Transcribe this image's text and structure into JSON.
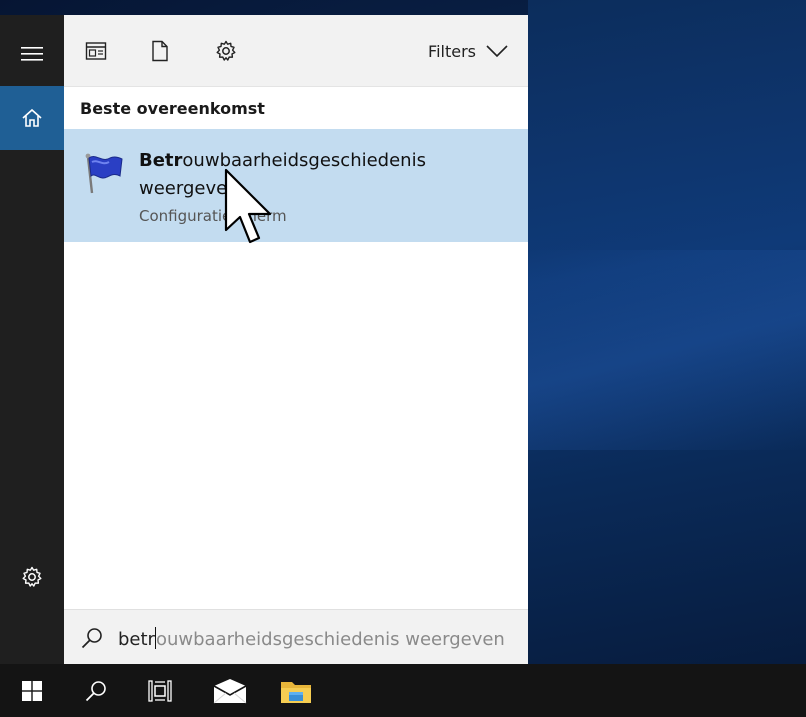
{
  "topbar": {
    "filters_label": "Filters",
    "icons": [
      "apps-icon",
      "document-icon",
      "gear-icon"
    ]
  },
  "results": {
    "section_title": "Beste overeenkomst",
    "best_match": {
      "title_bold": "Betr",
      "title_rest_line1": "ouwbaarheidsgeschiedenis",
      "title_line2": "weergeven",
      "subtitle": "Configuratiescherm",
      "icon": "blue-flag-icon"
    }
  },
  "search": {
    "typed": "betr",
    "autocomplete": "ouwbaarheidsgeschiedenis weergeven"
  },
  "rail": {
    "items": [
      "hamburger-menu-icon",
      "home-icon",
      "settings-icon"
    ]
  },
  "taskbar": {
    "items": [
      "windows-start-icon",
      "search-icon",
      "task-view-icon",
      "mail-icon",
      "file-explorer-icon"
    ]
  },
  "colors": {
    "rail_bg": "#1f1f1f",
    "home_active": "#1f5f95",
    "result_highlight": "#c3dcf0",
    "taskbar_bg": "#141414"
  }
}
